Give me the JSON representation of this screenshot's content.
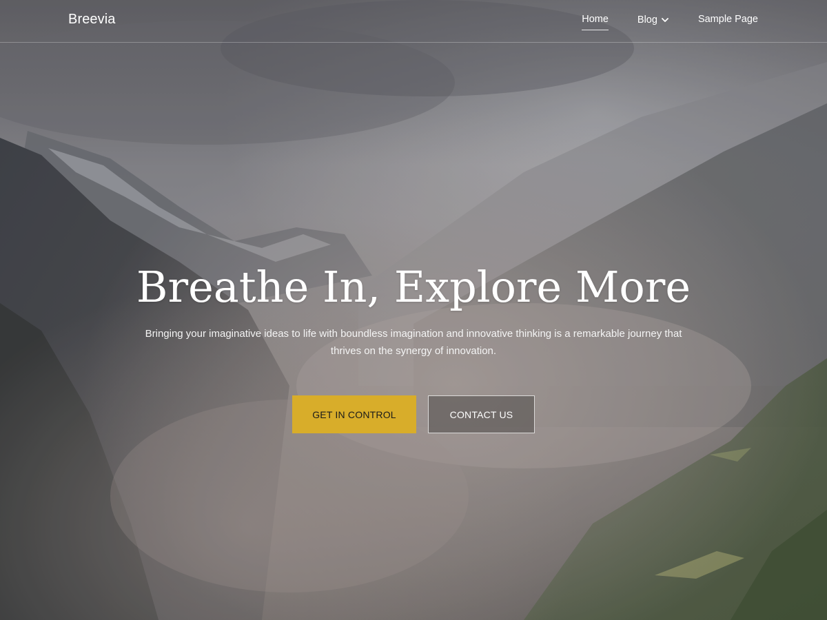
{
  "site": {
    "title": "Breevia"
  },
  "nav": {
    "items": [
      {
        "label": "Home",
        "active": true
      },
      {
        "label": "Blog",
        "has_dropdown": true,
        "icon": "chevron-down-icon"
      },
      {
        "label": "Sample Page"
      }
    ]
  },
  "hero": {
    "title": "Breathe In, Explore More",
    "subtitle": "Bringing your imaginative ideas to life with boundless imagination and innovative thinking is a remarkable journey that thrives on the synergy of innovation.",
    "primary_button": "GET IN CONTROL",
    "secondary_button": "CONTACT US"
  },
  "colors": {
    "accent": "#d8ad2a",
    "text_light": "#ffffff"
  }
}
